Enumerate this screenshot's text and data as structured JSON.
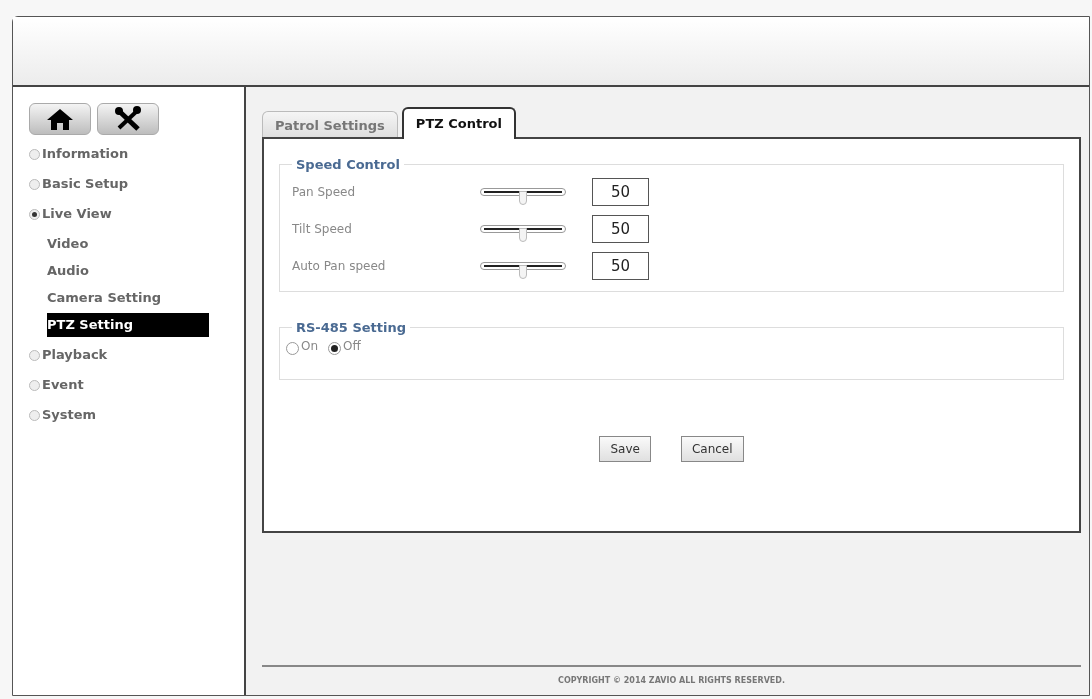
{
  "sidebar": {
    "items": [
      {
        "label": "Information",
        "selected": false
      },
      {
        "label": "Basic Setup",
        "selected": false
      },
      {
        "label": "Live View",
        "selected": true,
        "children": [
          {
            "label": "Video",
            "selected": false
          },
          {
            "label": "Audio",
            "selected": false
          },
          {
            "label": "Camera Setting",
            "selected": false
          },
          {
            "label": "PTZ Setting",
            "selected": true
          }
        ]
      },
      {
        "label": "Playback",
        "selected": false
      },
      {
        "label": "Event",
        "selected": false
      },
      {
        "label": "System",
        "selected": false
      }
    ]
  },
  "tabs": [
    {
      "label": "Patrol Settings",
      "selected": false
    },
    {
      "label": "PTZ Control",
      "selected": true
    }
  ],
  "speed_control": {
    "title": "Speed Control",
    "rows": [
      {
        "label": "Pan Speed",
        "level": 0.5,
        "value": "50"
      },
      {
        "label": "Tilt Speed",
        "level": 0.5,
        "value": "50"
      },
      {
        "label": "Auto Pan speed",
        "level": 0.5,
        "value": "50"
      }
    ]
  },
  "rs485": {
    "title": "RS-485 Setting",
    "options": [
      {
        "label": "On",
        "selected": false
      },
      {
        "label": "Off",
        "selected": true
      }
    ]
  },
  "buttons": [
    "Save",
    "Cancel"
  ],
  "footer": "COPYRIGHT © 2014 ZAVIO ALL RIGHTS RESERVED."
}
